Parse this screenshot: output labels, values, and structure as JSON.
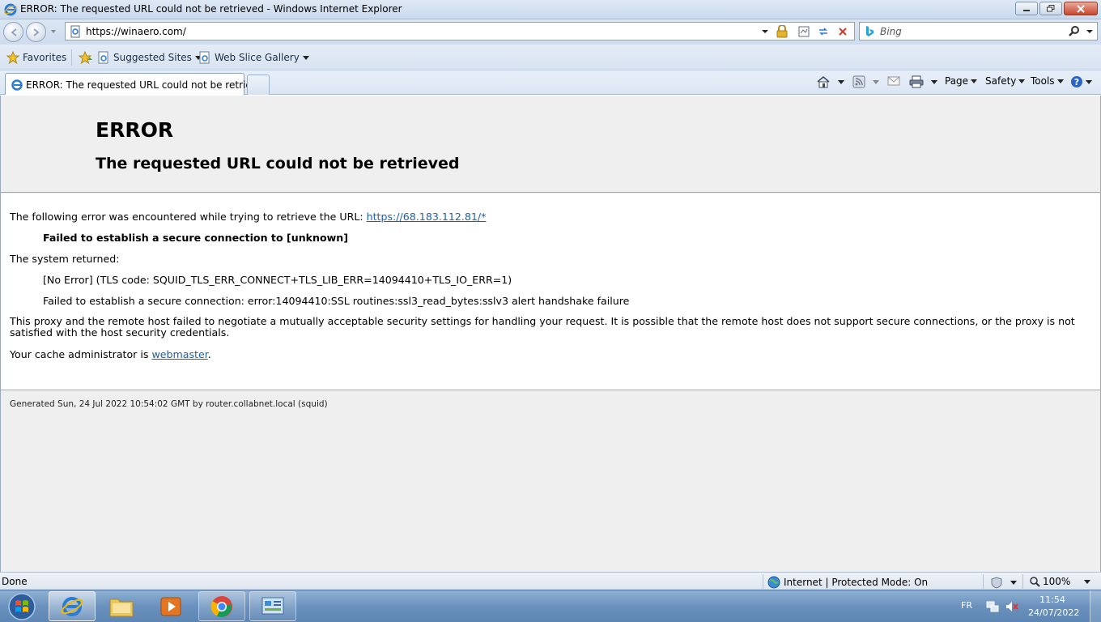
{
  "window": {
    "title": "ERROR: The requested URL could not be retrieved - Windows Internet Explorer"
  },
  "nav": {
    "url": "https://winaero.com/",
    "search_placeholder": "Bing"
  },
  "favorites_bar": {
    "favorites": "Favorites",
    "suggested_sites": "Suggested Sites",
    "web_slice_gallery": "Web Slice Gallery"
  },
  "tabs": [
    {
      "label": "ERROR: The requested URL could not be retrieved"
    }
  ],
  "command_bar": {
    "page": "Page",
    "safety": "Safety",
    "tools": "Tools"
  },
  "page": {
    "heading": "ERROR",
    "subheading": "The requested URL could not be retrieved",
    "intro": "The following error was encountered while trying to retrieve the URL:",
    "error_url": "https://68.183.112.81/*",
    "failure": "Failed to establish a secure connection to [unknown]",
    "system_returned": "The system returned:",
    "tls_code": "[No Error] (TLS code: SQUID_TLS_ERR_CONNECT+TLS_LIB_ERR=14094410+TLS_IO_ERR=1)",
    "ssl_error": "Failed to establish a secure connection: error:14094410:SSL routines:ssl3_read_bytes:sslv3 alert handshake failure",
    "explanation": "This proxy and the remote host failed to negotiate a mutually acceptable security settings for handling your request. It is possible that the remote host does not support secure connections, or the proxy is not satisfied with the host security credentials.",
    "admin_prefix": "Your cache administrator is",
    "admin_link": "webmaster",
    "admin_suffix": ".",
    "generated": "Generated Sun, 24 Jul 2022 10:54:02 GMT by router.collabnet.local (squid)"
  },
  "status": {
    "left": "Done",
    "zone": "Internet | Protected Mode: On",
    "zoom": "100%"
  },
  "taskbar": {
    "language": "FR",
    "time": "11:54",
    "date": "24/07/2022"
  },
  "colors": {
    "link": "#1a5fb4",
    "chrome": "#dbe6f3"
  }
}
